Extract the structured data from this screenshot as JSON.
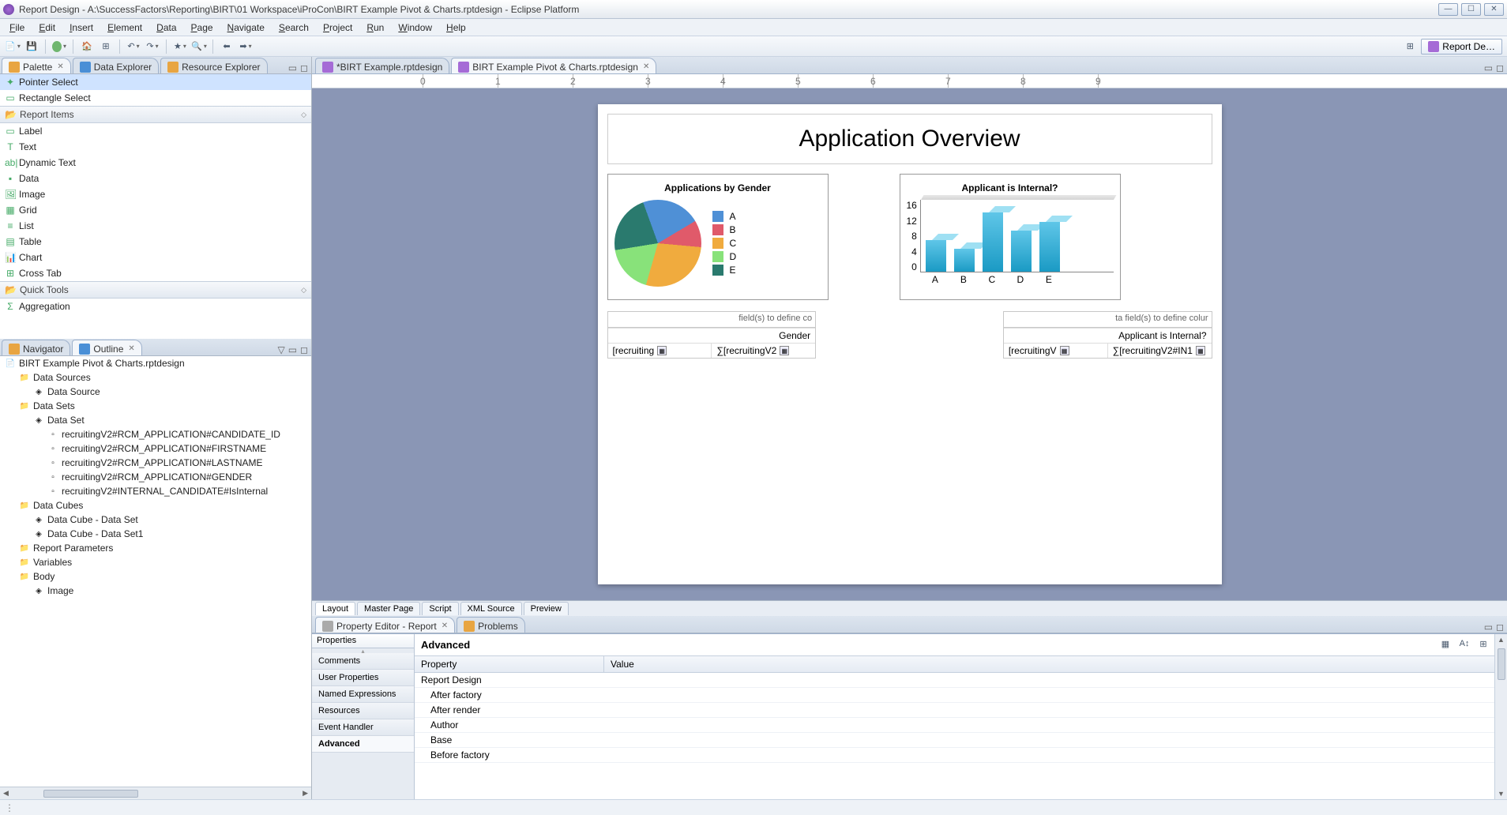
{
  "titlebar": {
    "title": "Report Design - A:\\SuccessFactors\\Reporting\\BIRT\\01 Workspace\\iProCon\\BIRT Example Pivot & Charts.rptdesign - Eclipse Platform"
  },
  "menubar": [
    "File",
    "Edit",
    "Insert",
    "Element",
    "Data",
    "Page",
    "Navigate",
    "Search",
    "Project",
    "Run",
    "Window",
    "Help"
  ],
  "perspective_label": "Report De…",
  "left_views": {
    "tabs": [
      "Palette",
      "Data Explorer",
      "Resource Explorer"
    ],
    "palette": {
      "pointer_select": "Pointer Select",
      "rectangle_select": "Rectangle Select",
      "cat_report_items": "Report Items",
      "items": [
        "Label",
        "Text",
        "Dynamic Text",
        "Data",
        "Image",
        "Grid",
        "List",
        "Table",
        "Chart",
        "Cross Tab"
      ],
      "cat_quick_tools": "Quick Tools",
      "aggregation": "Aggregation"
    }
  },
  "nav_outline": {
    "tabs": [
      "Navigator",
      "Outline"
    ],
    "root": "BIRT Example Pivot & Charts.rptdesign",
    "nodes": [
      {
        "l": "Data Sources",
        "d": 1
      },
      {
        "l": "Data Source",
        "d": 2
      },
      {
        "l": "Data Sets",
        "d": 1
      },
      {
        "l": "Data Set",
        "d": 2
      },
      {
        "l": "recruitingV2#RCM_APPLICATION#CANDIDATE_ID",
        "d": 3
      },
      {
        "l": "recruitingV2#RCM_APPLICATION#FIRSTNAME",
        "d": 3
      },
      {
        "l": "recruitingV2#RCM_APPLICATION#LASTNAME",
        "d": 3
      },
      {
        "l": "recruitingV2#RCM_APPLICATION#GENDER",
        "d": 3
      },
      {
        "l": "recruitingV2#INTERNAL_CANDIDATE#IsInternal",
        "d": 3
      },
      {
        "l": "Data Cubes",
        "d": 1
      },
      {
        "l": "Data Cube - Data Set",
        "d": 2
      },
      {
        "l": "Data Cube - Data Set1",
        "d": 2
      },
      {
        "l": "Report Parameters",
        "d": 1
      },
      {
        "l": "Variables",
        "d": 1
      },
      {
        "l": "Body",
        "d": 1
      },
      {
        "l": "Image",
        "d": 2
      }
    ]
  },
  "editor": {
    "tabs": [
      "*BIRT Example.rptdesign",
      "BIRT Example Pivot & Charts.rptdesign"
    ],
    "active_tab": 1,
    "bottom_tabs": [
      "Layout",
      "Master Page",
      "Script",
      "XML Source",
      "Preview"
    ],
    "active_bottom": 0
  },
  "report": {
    "title": "Application Overview",
    "pie_title": "Applications by Gender",
    "bar_title": "Applicant is Internal?",
    "pivot1": {
      "hint": "field(s) to define co",
      "header": "Gender",
      "r1": "[recruiting",
      "r2": "∑[recruitingV2"
    },
    "pivot2": {
      "hint": "ta field(s) to define colur",
      "header": "Applicant is Internal?",
      "r1": "[recruitingV",
      "r2": "∑[recruitingV2#IN1"
    }
  },
  "property_editor": {
    "tabs": [
      "Property Editor - Report",
      "Problems"
    ],
    "sub_tabs": [
      "Properties"
    ],
    "categories": [
      "Comments",
      "User Properties",
      "Named Expressions",
      "Resources",
      "Event Handler",
      "Advanced"
    ],
    "active_cat": "Advanced",
    "header": "Advanced",
    "col_property": "Property",
    "col_value": "Value",
    "rows": [
      {
        "p": "Report Design",
        "v": "",
        "lvl": 0
      },
      {
        "p": "After factory",
        "v": "",
        "lvl": 1
      },
      {
        "p": "After render",
        "v": "",
        "lvl": 1
      },
      {
        "p": "Author",
        "v": "",
        "lvl": 1
      },
      {
        "p": "Base",
        "v": "",
        "lvl": 1
      },
      {
        "p": "Before factory",
        "v": "",
        "lvl": 1
      }
    ]
  },
  "chart_data": [
    {
      "type": "pie",
      "title": "Applications by Gender",
      "categories": [
        "A",
        "B",
        "C",
        "D",
        "E"
      ],
      "values": [
        22,
        10,
        28,
        18,
        22
      ],
      "colors": [
        "#4f90d6",
        "#e05a6a",
        "#f0ab3e",
        "#88e27a",
        "#2a7a6e"
      ]
    },
    {
      "type": "bar",
      "title": "Applicant is Internal?",
      "categories": [
        "A",
        "B",
        "C",
        "D",
        "E"
      ],
      "values": [
        7,
        5,
        13,
        9,
        11
      ],
      "ylim": [
        0,
        16
      ],
      "yticks": [
        0,
        4,
        8,
        12,
        16
      ],
      "xlabel": "",
      "ylabel": ""
    }
  ]
}
